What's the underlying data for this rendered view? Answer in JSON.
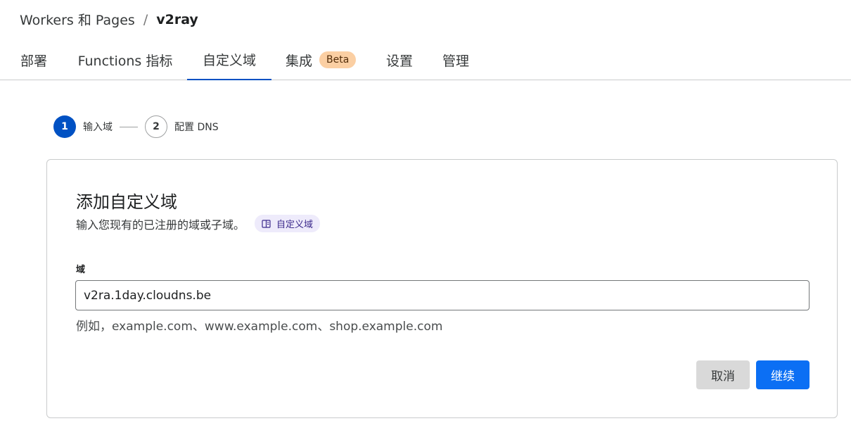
{
  "breadcrumb": {
    "parent": "Workers 和 Pages",
    "separator": "/",
    "current": "v2ray"
  },
  "tabs": [
    {
      "label": "部署"
    },
    {
      "label": "Functions 指标"
    },
    {
      "label": "自定义域"
    },
    {
      "label": "集成",
      "badge": "Beta"
    },
    {
      "label": "设置"
    },
    {
      "label": "管理"
    }
  ],
  "stepper": {
    "steps": [
      {
        "number": "1",
        "label": "输入域"
      },
      {
        "number": "2",
        "label": "配置 DNS"
      }
    ]
  },
  "form": {
    "title": "添加自定义域",
    "subtitle": "输入您现有的已注册的域或子域。",
    "doc_link": "自定义域",
    "field_label": "域",
    "field_value": "v2ra.1day.cloudns.be",
    "help_text": "例如，example.com、www.example.com、shop.example.com",
    "cancel_label": "取消",
    "continue_label": "继续"
  },
  "colors": {
    "accent": "#0051c3",
    "primary_button": "#0b6ff4",
    "badge_bg": "#fbcfa3",
    "doc_link_bg": "#eeebfb"
  }
}
